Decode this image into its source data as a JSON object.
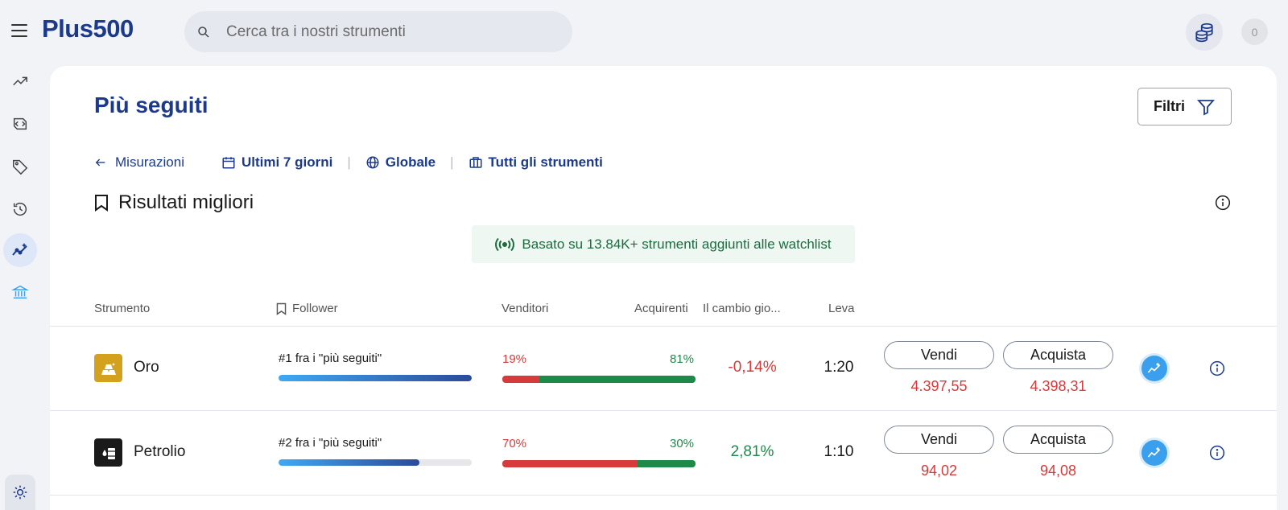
{
  "header": {
    "logo_text": "Plus500",
    "search_placeholder": "Cerca tra i nostri strumenti",
    "account_badge": "0"
  },
  "page": {
    "title": "Più seguiti",
    "filters_label": "Filtri",
    "back_label": "Misurazioni",
    "period_label": "Ultimi 7 giorni",
    "region_label": "Globale",
    "instruments_label": "Tutti gli strumenti",
    "section_title": "Risultati migliori",
    "banner_text": "Basato su 13.84K+ strumenti aggiunti alle watchlist"
  },
  "table": {
    "headers": {
      "instrument": "Strumento",
      "followers": "Follower",
      "sellers": "Venditori",
      "buyers": "Acquirenti",
      "daily_change": "Il cambio gio...",
      "leverage": "Leva"
    },
    "rows": [
      {
        "name": "Oro",
        "icon": "gold-bars-icon",
        "icon_bg": "#d4a11e",
        "rank_text": "#1 fra i \"più seguiti\"",
        "follower_fill": 1.0,
        "sell_pct": "19%",
        "buy_pct": "81%",
        "sell_ratio": 0.19,
        "change": "-0,14%",
        "change_color": "#d63a3a",
        "leverage": "1:20",
        "sell_label": "Vendi",
        "buy_label": "Acquista",
        "sell_price": "4.397,55",
        "buy_price": "4.398,31"
      },
      {
        "name": "Petrolio",
        "icon": "oil-barrel-icon",
        "icon_bg": "#1a1a1a",
        "rank_text": "#2 fra i \"più seguiti\"",
        "follower_fill": 0.73,
        "sell_pct": "70%",
        "buy_pct": "30%",
        "sell_ratio": 0.7,
        "change": "2,81%",
        "change_color": "#1d8a4a",
        "leverage": "1:10",
        "sell_label": "Vendi",
        "buy_label": "Acquista",
        "sell_price": "94,02",
        "buy_price": "94,08"
      }
    ]
  },
  "colors": {
    "brand": "#1b3a8c",
    "sell": "#d63a3a",
    "buy": "#1d8a4a"
  }
}
